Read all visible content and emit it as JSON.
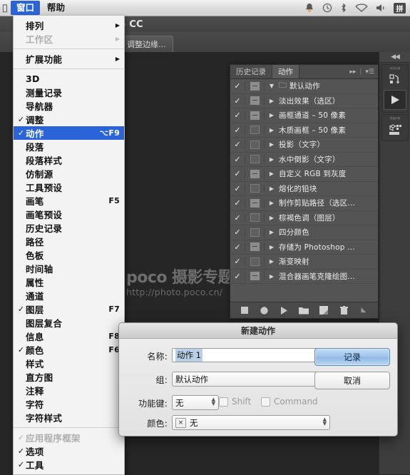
{
  "menubar": {
    "apple_icon": "apple-icon",
    "items": [
      {
        "label": "窗口",
        "active": true
      },
      {
        "label": "帮助",
        "active": false
      }
    ],
    "status_icons": [
      "bell-icon",
      "time-machine-icon",
      "bluetooth-icon",
      "wifi-icon",
      "volume-icon"
    ],
    "ime_label": "拼"
  },
  "app": {
    "title": "hop CC",
    "refine_edge_button": "调整边缘..."
  },
  "watermark": {
    "line1": "poco 摄影专题",
    "line2": "http://photo.poco.cn/"
  },
  "window_menu": {
    "groups": [
      {
        "items": [
          {
            "label": "排列",
            "checked": false,
            "disabled": false,
            "submenu": true,
            "shortcut": ""
          },
          {
            "label": "工作区",
            "checked": false,
            "disabled": true,
            "submenu": true,
            "shortcut": ""
          }
        ]
      },
      {
        "items": [
          {
            "label": "扩展功能",
            "checked": false,
            "disabled": false,
            "submenu": true,
            "shortcut": ""
          }
        ]
      },
      {
        "items": [
          {
            "label": "3D",
            "checked": false,
            "disabled": false,
            "submenu": false,
            "shortcut": ""
          },
          {
            "label": "测量记录",
            "checked": false,
            "disabled": false,
            "submenu": false,
            "shortcut": ""
          },
          {
            "label": "导航器",
            "checked": false,
            "disabled": false,
            "submenu": false,
            "shortcut": ""
          },
          {
            "label": "调整",
            "checked": true,
            "disabled": false,
            "submenu": false,
            "shortcut": ""
          },
          {
            "label": "动作",
            "checked": true,
            "disabled": false,
            "submenu": false,
            "shortcut": "⌥F9",
            "selected": true
          },
          {
            "label": "段落",
            "checked": false,
            "disabled": false,
            "submenu": false,
            "shortcut": ""
          },
          {
            "label": "段落样式",
            "checked": false,
            "disabled": false,
            "submenu": false,
            "shortcut": ""
          },
          {
            "label": "仿制源",
            "checked": false,
            "disabled": false,
            "submenu": false,
            "shortcut": ""
          },
          {
            "label": "工具预设",
            "checked": false,
            "disabled": false,
            "submenu": false,
            "shortcut": ""
          },
          {
            "label": "画笔",
            "checked": false,
            "disabled": false,
            "submenu": false,
            "shortcut": "F5"
          },
          {
            "label": "画笔预设",
            "checked": false,
            "disabled": false,
            "submenu": false,
            "shortcut": ""
          },
          {
            "label": "历史记录",
            "checked": false,
            "disabled": false,
            "submenu": false,
            "shortcut": ""
          },
          {
            "label": "路径",
            "checked": false,
            "disabled": false,
            "submenu": false,
            "shortcut": ""
          },
          {
            "label": "色板",
            "checked": false,
            "disabled": false,
            "submenu": false,
            "shortcut": ""
          },
          {
            "label": "时间轴",
            "checked": false,
            "disabled": false,
            "submenu": false,
            "shortcut": ""
          },
          {
            "label": "属性",
            "checked": false,
            "disabled": false,
            "submenu": false,
            "shortcut": ""
          },
          {
            "label": "通道",
            "checked": false,
            "disabled": false,
            "submenu": false,
            "shortcut": ""
          },
          {
            "label": "图层",
            "checked": true,
            "disabled": false,
            "submenu": false,
            "shortcut": "F7"
          },
          {
            "label": "图层复合",
            "checked": false,
            "disabled": false,
            "submenu": false,
            "shortcut": ""
          },
          {
            "label": "信息",
            "checked": false,
            "disabled": false,
            "submenu": false,
            "shortcut": "F8"
          },
          {
            "label": "颜色",
            "checked": true,
            "disabled": false,
            "submenu": false,
            "shortcut": "F6"
          },
          {
            "label": "样式",
            "checked": false,
            "disabled": false,
            "submenu": false,
            "shortcut": ""
          },
          {
            "label": "直方图",
            "checked": false,
            "disabled": false,
            "submenu": false,
            "shortcut": ""
          },
          {
            "label": "注释",
            "checked": false,
            "disabled": false,
            "submenu": false,
            "shortcut": ""
          },
          {
            "label": "字符",
            "checked": false,
            "disabled": false,
            "submenu": false,
            "shortcut": ""
          },
          {
            "label": "字符样式",
            "checked": false,
            "disabled": false,
            "submenu": false,
            "shortcut": ""
          }
        ]
      },
      {
        "items": [
          {
            "label": "应用程序框架",
            "checked": true,
            "disabled": true,
            "submenu": false,
            "shortcut": ""
          },
          {
            "label": "选项",
            "checked": true,
            "disabled": false,
            "submenu": false,
            "shortcut": ""
          },
          {
            "label": "工具",
            "checked": true,
            "disabled": false,
            "submenu": false,
            "shortcut": ""
          }
        ]
      }
    ]
  },
  "actions_panel": {
    "tabs": [
      {
        "label": "历史记录",
        "active": false
      },
      {
        "label": "动作",
        "active": true
      }
    ],
    "collapse_icon": "double-chevron-right-icon",
    "menu_icon": "panel-menu-icon",
    "rows": [
      {
        "label": "默认动作",
        "checked": true,
        "box": "on",
        "kind": "folder",
        "expanded": true
      },
      {
        "label": "淡出效果（选区）",
        "checked": true,
        "box": "on",
        "kind": "action"
      },
      {
        "label": "画框通道 – 50 像素",
        "checked": true,
        "box": "on",
        "kind": "action"
      },
      {
        "label": "木质画框 – 50 像素",
        "checked": true,
        "box": "empty",
        "kind": "action"
      },
      {
        "label": "投影（文字）",
        "checked": true,
        "box": "empty",
        "kind": "action"
      },
      {
        "label": "水中倒影（文字）",
        "checked": true,
        "box": "empty",
        "kind": "action"
      },
      {
        "label": "自定义 RGB 到灰度",
        "checked": true,
        "box": "on",
        "kind": "action"
      },
      {
        "label": "熔化的铅块",
        "checked": true,
        "box": "empty",
        "kind": "action"
      },
      {
        "label": "制作剪贴路径（选区...",
        "checked": true,
        "box": "on",
        "kind": "action"
      },
      {
        "label": "棕褐色调（图层）",
        "checked": true,
        "box": "empty",
        "kind": "action"
      },
      {
        "label": "四分颜色",
        "checked": true,
        "box": "empty",
        "kind": "action"
      },
      {
        "label": "存储为 Photoshop ...",
        "checked": true,
        "box": "on",
        "kind": "action"
      },
      {
        "label": "渐变映射",
        "checked": true,
        "box": "empty",
        "kind": "action"
      },
      {
        "label": "混合器画笔克隆绘图...",
        "checked": true,
        "box": "on",
        "kind": "action"
      }
    ],
    "footer_icons": [
      "stop-icon",
      "record-icon",
      "play-icon",
      "new-set-folder-icon",
      "new-action-icon",
      "delete-trash-icon"
    ]
  },
  "dock": {
    "collapse_icon": "collapse-panels-icon",
    "groups": [
      {
        "label": "历史记录",
        "icon": "history-icon",
        "selected": false
      },
      {
        "label": "",
        "icon": "actions-play-icon",
        "selected": true
      },
      {
        "label": "测量记录",
        "icon": "measurement-log-icon",
        "selected": false
      }
    ]
  },
  "dialog": {
    "title": "新建动作",
    "name_label": "名称:",
    "name_value": "动作 1",
    "set_label": "组:",
    "set_value": "默认动作",
    "fkey_label": "功能键:",
    "fkey_value": "无",
    "shift_label": "Shift",
    "command_label": "Command",
    "color_label": "颜色:",
    "color_value": "无",
    "color_swatch_glyph": "×",
    "record_button": "记录",
    "cancel_button": "取消"
  },
  "colors": {
    "accent_blue": "#2a64d8",
    "canvas_bg": "#262626",
    "panel_bg": "#545454",
    "dock_bg": "#3d3d3d"
  }
}
